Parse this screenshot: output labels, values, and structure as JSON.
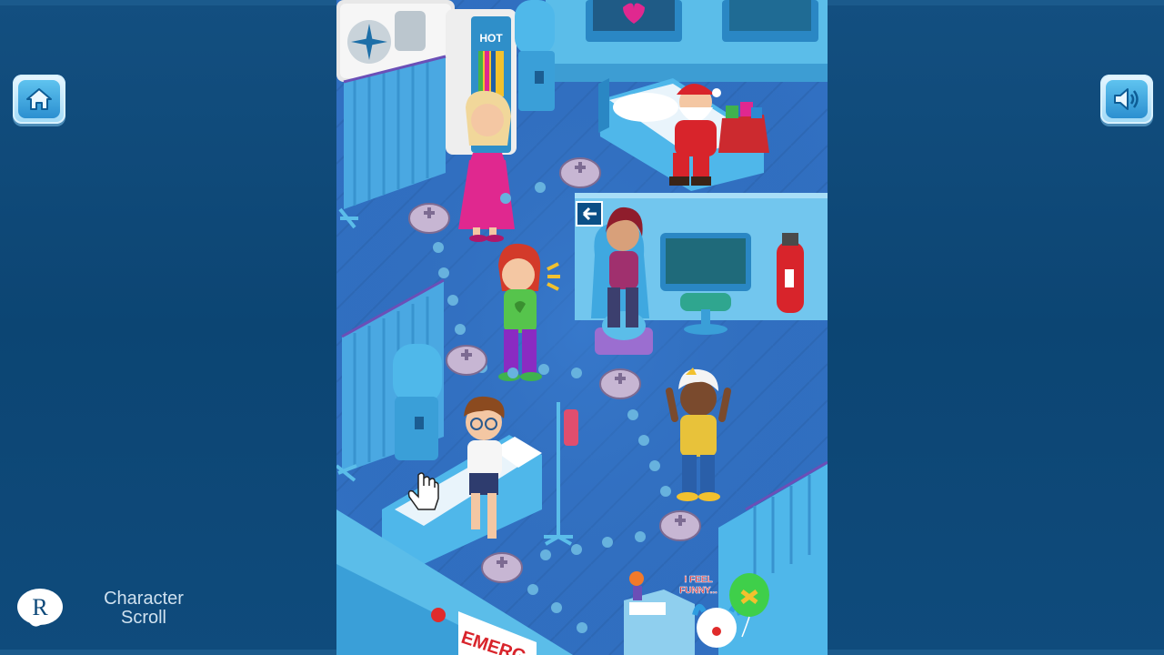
{
  "colors": {
    "sidebar": "#0f4a7a",
    "floor": "#2f6fc0",
    "wall": "#5bbde9",
    "button_face": "#2b8fd0",
    "stop_pad": "#b6a3c4",
    "path_dot": "#67b2de"
  },
  "toolbar": {
    "home_icon": "home-icon",
    "sound_icon": "speaker-icon"
  },
  "branding": {
    "logo_letter": "R",
    "caption_line1": "Character",
    "caption_line2": "Scroll"
  },
  "scene": {
    "vending_label": "HOT",
    "balloon_text_line1": "I FEEL",
    "balloon_text_line2": "FUNNY...",
    "sign_text": "EMERG",
    "back_arrow_icon": "arrow-left-icon",
    "extinguisher_icon": "fire-extinguisher-icon",
    "monitor_icon": "heart-icon"
  },
  "characters": [
    {
      "name": "santa"
    },
    {
      "name": "blonde-girl-pink-dress"
    },
    {
      "name": "red-hair-girl-green-shirt"
    },
    {
      "name": "woman-in-chair"
    },
    {
      "name": "boy-with-glasses"
    },
    {
      "name": "man-with-head-bandage"
    },
    {
      "name": "clown"
    }
  ]
}
